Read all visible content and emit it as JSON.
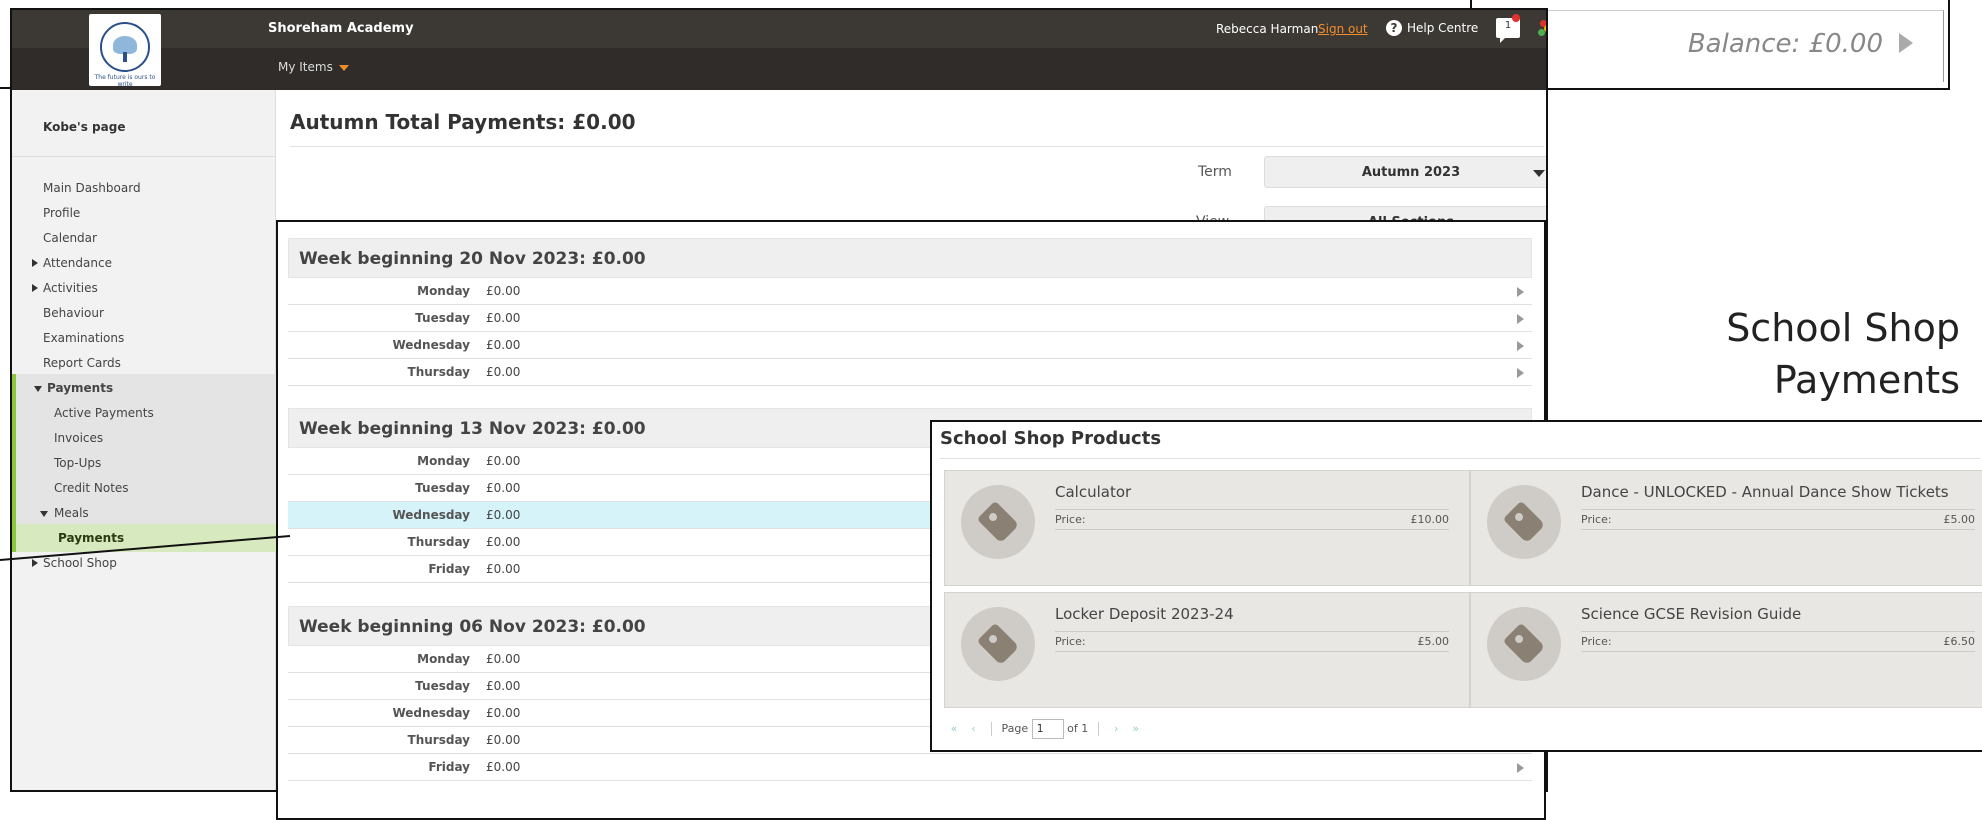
{
  "balance": {
    "text": "Balance: £0.00"
  },
  "header": {
    "school_name": "Shoreham Academy",
    "my_items": "My Items",
    "user_name": "Rebecca Harman",
    "sign_out": "Sign out",
    "help_centre": "Help Centre",
    "message_count": "1",
    "logo_text": "Shoreham Academy",
    "logo_tagline": "The future is ours to write"
  },
  "sidebar": {
    "child_page": "Kobe's page",
    "items": [
      {
        "label": "Main Dashboard"
      },
      {
        "label": "Profile"
      },
      {
        "label": "Calendar"
      },
      {
        "label": "Attendance"
      },
      {
        "label": "Activities"
      },
      {
        "label": "Behaviour"
      },
      {
        "label": "Examinations"
      },
      {
        "label": "Report Cards"
      },
      {
        "label": "Payments"
      },
      {
        "label": "Active Payments"
      },
      {
        "label": "Invoices"
      },
      {
        "label": "Top-Ups"
      },
      {
        "label": "Credit Notes"
      },
      {
        "label": "Meals"
      },
      {
        "label": "Payments"
      },
      {
        "label": "School Shop"
      }
    ]
  },
  "main": {
    "heading": "Autumn Total Payments: £0.00",
    "term_label": "Term",
    "term_value": "Autumn 2023",
    "view_label": "View",
    "view_value": "All Sections",
    "weeks": [
      {
        "title": "Week beginning 20 Nov 2023: £0.00",
        "days": [
          {
            "day": "Monday",
            "amount": "£0.00"
          },
          {
            "day": "Tuesday",
            "amount": "£0.00"
          },
          {
            "day": "Wednesday",
            "amount": "£0.00"
          },
          {
            "day": "Thursday",
            "amount": "£0.00"
          }
        ]
      },
      {
        "title": "Week beginning 13 Nov 2023: £0.00",
        "days": [
          {
            "day": "Monday",
            "amount": "£0.00"
          },
          {
            "day": "Tuesday",
            "amount": "£0.00"
          },
          {
            "day": "Wednesday",
            "amount": "£0.00"
          },
          {
            "day": "Thursday",
            "amount": "£0.00"
          },
          {
            "day": "Friday",
            "amount": "£0.00"
          }
        ]
      },
      {
        "title": "Week beginning 06 Nov 2023: £0.00",
        "days": [
          {
            "day": "Monday",
            "amount": "£0.00"
          },
          {
            "day": "Tuesday",
            "amount": "£0.00"
          },
          {
            "day": "Wednesday",
            "amount": "£0.00"
          },
          {
            "day": "Thursday",
            "amount": "£0.00"
          },
          {
            "day": "Friday",
            "amount": "£0.00"
          }
        ]
      }
    ]
  },
  "shop": {
    "title_line1": "School Shop",
    "title_line2": "Payments",
    "heading": "School Shop Products",
    "price_label": "Price:",
    "products": [
      {
        "name": "Calculator",
        "price": "£10.00"
      },
      {
        "name": "Dance - UNLOCKED - Annual Dance Show Tickets",
        "price": "£5.00"
      },
      {
        "name": "Locker Deposit 2023-24",
        "price": "£5.00"
      },
      {
        "name": "Science GCSE Revision Guide",
        "price": "£6.50"
      }
    ],
    "pager": {
      "page_label": "Page",
      "page_value": "1",
      "of_label": "of 1"
    }
  },
  "colors": {
    "accent_orange": "#f18d2a",
    "nav_green": "#8cc63f",
    "highlight_row": "#d5f3f8",
    "topbar": "#3c3935"
  }
}
